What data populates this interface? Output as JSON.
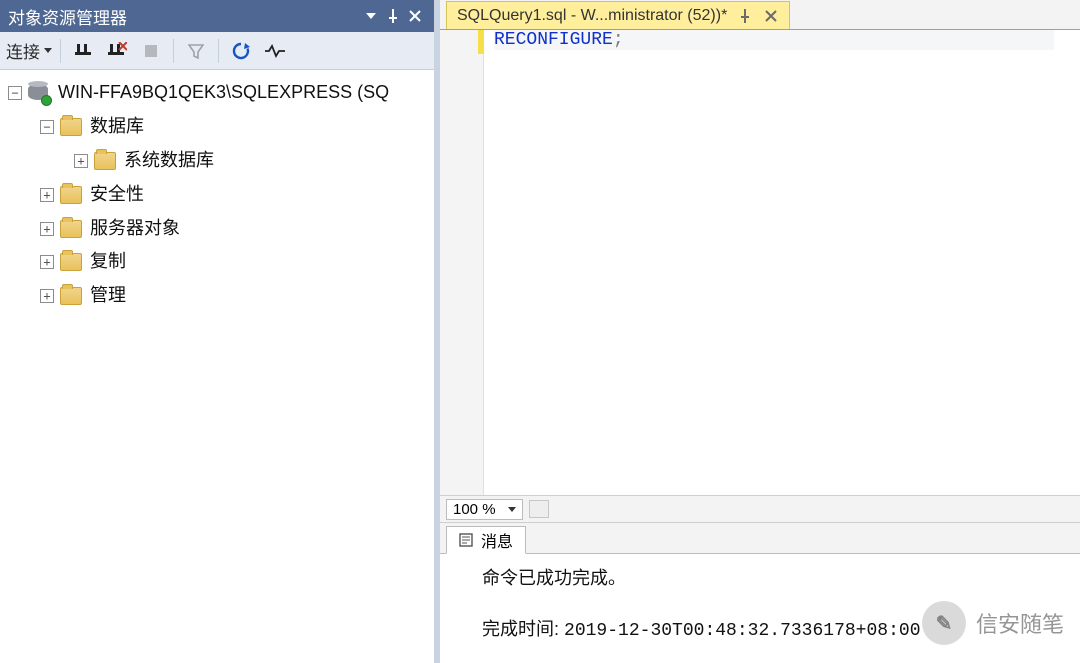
{
  "objectExplorer": {
    "title": "对象资源管理器",
    "toolbar": {
      "connect_label": "连接"
    },
    "tree": {
      "server": "WIN-FFA9BQ1QEK3\\SQLEXPRESS (SQ",
      "nodes": [
        {
          "label": "数据库",
          "expanded": true,
          "children": [
            {
              "label": "系统数据库",
              "expanded": false
            }
          ]
        },
        {
          "label": "安全性",
          "expanded": false
        },
        {
          "label": "服务器对象",
          "expanded": false
        },
        {
          "label": "复制",
          "expanded": false
        },
        {
          "label": "管理",
          "expanded": false
        }
      ]
    }
  },
  "editor": {
    "tab_label": "SQLQuery1.sql - W...ministrator (52))*",
    "code_keyword": "RECONFIGURE",
    "zoom": "100 %"
  },
  "messages": {
    "tab_label": "消息",
    "success_text": "命令已成功完成。",
    "timestamp_label": "完成时间:",
    "timestamp_value": "2019-12-30T00:48:32.7336178+08:00"
  },
  "watermark": "信安随笔"
}
